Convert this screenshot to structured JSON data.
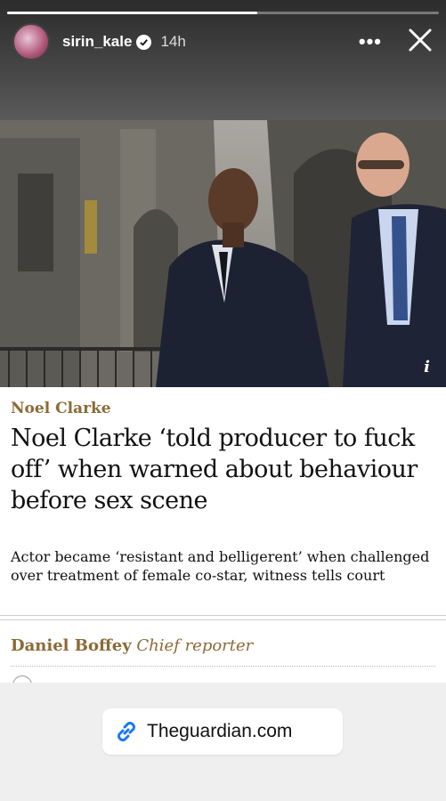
{
  "story": {
    "username": "sirin_kale",
    "time": "14h",
    "more_label": "•••",
    "progress_fraction": 0.58
  },
  "article": {
    "kicker": "Noel Clarke",
    "headline": "Noel Clarke ‘told producer to fuck off’ when warned about behaviour before sex scene",
    "standfirst": "Actor became ‘resistant and belligerent’ when challenged over treatment of female co-star, witness tells court",
    "author": "Daniel Boffey",
    "author_role": "Chief reporter",
    "photo_info_label": "i"
  },
  "link_sticker": {
    "text": "Theguardian.com",
    "color": "#1877f2"
  },
  "colors": {
    "kicker": "#8c6a36",
    "footer_bg": "#efefef"
  }
}
